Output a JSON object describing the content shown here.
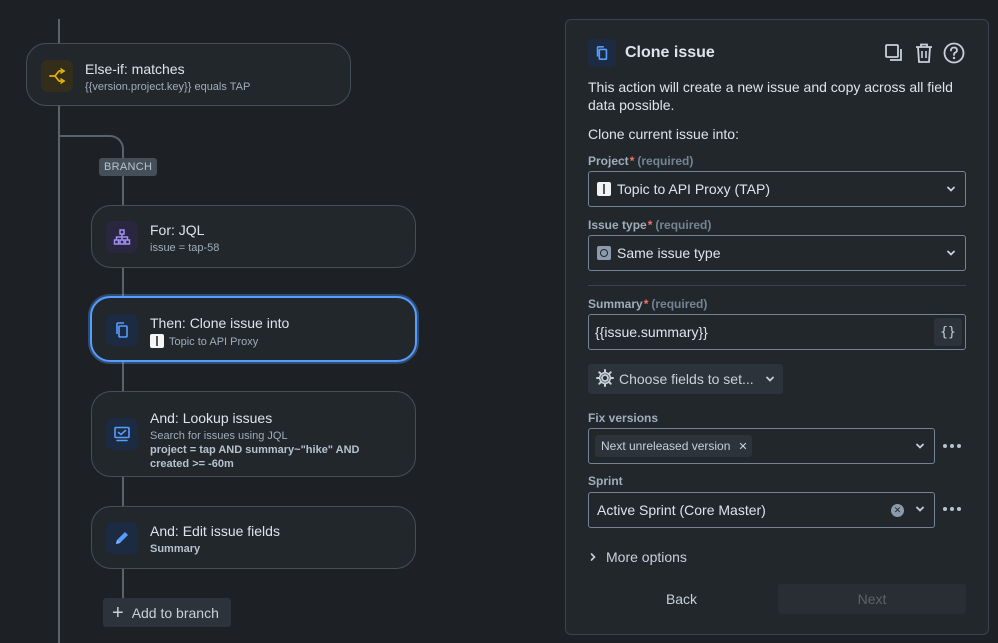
{
  "canvas": {
    "nodes": {
      "else_if": {
        "title": "Else-if: matches",
        "sub": "{{version.project.key}} equals TAP",
        "icon": "branch-condition-icon",
        "icon_color": "#e2b203"
      },
      "branch_label": "BRANCH",
      "for_jql": {
        "title": "For: JQL",
        "sub": "issue = tap-58",
        "icon": "hierarchy-icon",
        "icon_color": "#9f8fef"
      },
      "clone": {
        "title": "Then: Clone issue into",
        "sub": "Topic to API Proxy",
        "icon": "clone-icon",
        "icon_color": "#579dff"
      },
      "lookup": {
        "title": "And: Lookup issues",
        "sub": "Search for issues using JQL",
        "sub_bold": "project = tap AND summary~\"hike\" AND created >= -60m",
        "icon": "lookup-icon",
        "icon_color": "#579dff"
      },
      "edit": {
        "title": "And: Edit issue fields",
        "sub_bold": "Summary",
        "icon": "pencil-icon",
        "icon_color": "#579dff"
      }
    },
    "add_to_branch": "Add to branch"
  },
  "panel": {
    "title": "Clone issue",
    "description": "This action will create a new issue and copy across all field data possible.",
    "clone_into_label": "Clone current issue into:",
    "project": {
      "label": "Project",
      "required_text": "(required)",
      "value": "Topic to API Proxy (TAP)"
    },
    "issue_type": {
      "label": "Issue type",
      "required_text": "(required)",
      "value": "Same issue type"
    },
    "summary": {
      "label": "Summary",
      "required_text": "(required)",
      "value": "{{issue.summary}}",
      "smart_value_button": "{}"
    },
    "choose_fields": "Choose fields to set...",
    "fix_versions": {
      "label": "Fix versions",
      "tag": "Next unreleased version"
    },
    "sprint": {
      "label": "Sprint",
      "value": "Active Sprint (Core Master)"
    },
    "more_options": "More options",
    "back": "Back",
    "next": "Next"
  },
  "colors": {
    "accent": "#579dff",
    "required": "#f87168",
    "background": "#1d2125",
    "surface": "#22272b"
  }
}
